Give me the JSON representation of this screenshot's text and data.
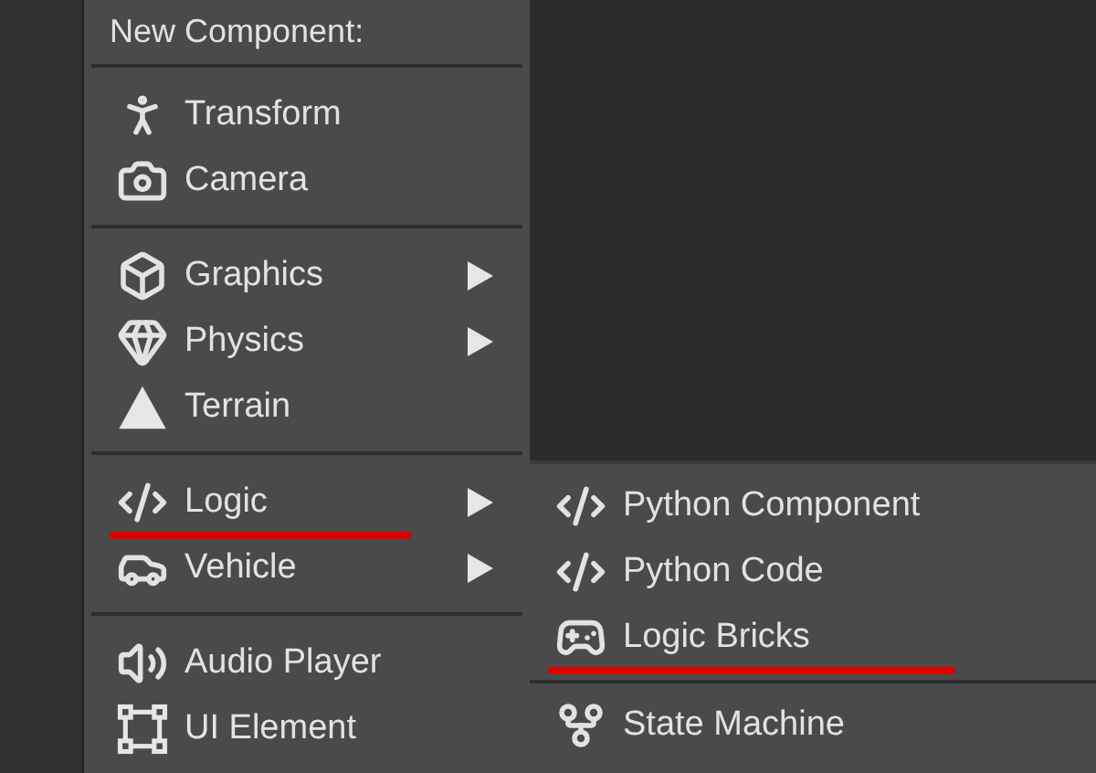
{
  "menu": {
    "title": "New Component:",
    "groups": [
      {
        "items": [
          {
            "label": "Transform",
            "has_submenu": false,
            "underlined": false
          },
          {
            "label": "Camera",
            "has_submenu": false,
            "underlined": false
          }
        ]
      },
      {
        "items": [
          {
            "label": "Graphics",
            "has_submenu": true,
            "underlined": false
          },
          {
            "label": "Physics",
            "has_submenu": true,
            "underlined": false
          },
          {
            "label": "Terrain",
            "has_submenu": false,
            "underlined": false
          }
        ]
      },
      {
        "items": [
          {
            "label": "Logic",
            "has_submenu": true,
            "underlined": true
          },
          {
            "label": "Vehicle",
            "has_submenu": true,
            "underlined": false
          }
        ]
      },
      {
        "items": [
          {
            "label": "Audio Player",
            "has_submenu": false,
            "underlined": false
          },
          {
            "label": "UI Element",
            "has_submenu": false,
            "underlined": false
          }
        ]
      }
    ]
  },
  "submenu": {
    "groups": [
      {
        "items": [
          {
            "label": "Python Component",
            "underlined": false
          },
          {
            "label": "Python Code",
            "underlined": false
          },
          {
            "label": "Logic Bricks",
            "underlined": true
          }
        ]
      },
      {
        "items": [
          {
            "label": "State Machine",
            "underlined": false
          }
        ]
      }
    ]
  }
}
